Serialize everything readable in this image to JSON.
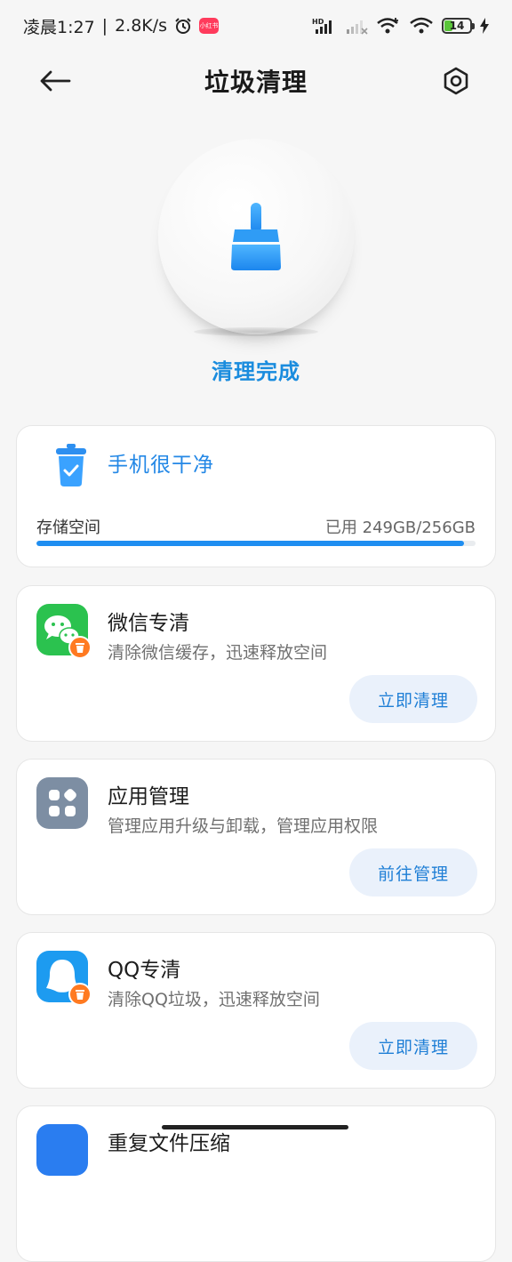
{
  "status_bar": {
    "time": "凌晨1:27",
    "separator": "|",
    "speed": "2.8K/s",
    "app_badge": "小红书",
    "battery": "14"
  },
  "header": {
    "title": "垃圾清理"
  },
  "hero": {
    "status": "清理完成"
  },
  "storage": {
    "status": "手机很干净",
    "label": "存储空间",
    "used_text": "已用 249GB/256GB",
    "used_fraction": 0.9727
  },
  "features": [
    {
      "title": "微信专清",
      "desc": "清除微信缓存，迅速释放空间",
      "button": "立即清理",
      "icon": "wechat-icon"
    },
    {
      "title": "应用管理",
      "desc": "管理应用升级与卸载，管理应用权限",
      "button": "前往管理",
      "icon": "apps-icon"
    },
    {
      "title": "QQ专清",
      "desc": "清除QQ垃圾，迅速释放空间",
      "button": "立即清理",
      "icon": "qq-icon"
    },
    {
      "title": "重复文件压缩",
      "icon": "duplicate-files-icon"
    }
  ],
  "colors": {
    "accent": "#1f8ef1",
    "wechat": "#2bc24f",
    "qq": "#1d9bf0",
    "apps": "#7d8ea3",
    "badge": "#ff7a21"
  }
}
